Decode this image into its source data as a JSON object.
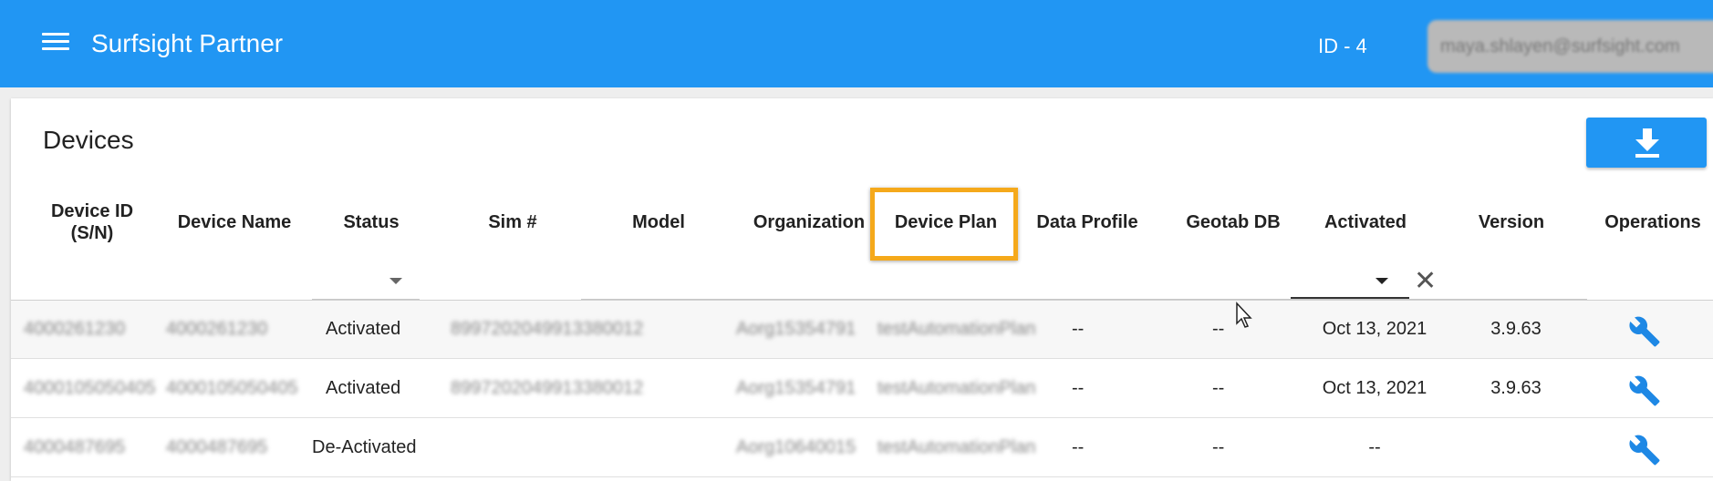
{
  "appbar": {
    "title": "Surfsight Partner",
    "id_label": "ID - 4",
    "user_email": "maya.shlayen@surfsight.com"
  },
  "page": {
    "title": "Devices"
  },
  "table": {
    "columns": {
      "device_id": "Device ID (S/N)",
      "device_name": "Device Name",
      "status": "Status",
      "sim": "Sim #",
      "model": "Model",
      "organization": "Organization",
      "device_plan": "Device Plan",
      "data_profile": "Data Profile",
      "geotab_db": "Geotab DB",
      "activated": "Activated",
      "version": "Version",
      "operations": "Operations"
    },
    "rows": [
      {
        "device_id": "4000261230",
        "device_name": "4000261230",
        "status": "Activated",
        "sim": "8997202049913380012",
        "model": "",
        "organization": "Aorg15354791",
        "device_plan": "testAutomationPlan",
        "data_profile": "--",
        "geotab_db": "--",
        "activated": "Oct 13, 2021",
        "version": "3.9.63"
      },
      {
        "device_id": "4000105050405",
        "device_name": "4000105050405",
        "status": "Activated",
        "sim": "8997202049913380012",
        "model": "",
        "organization": "Aorg15354791",
        "device_plan": "testAutomationPlan",
        "data_profile": "--",
        "geotab_db": "--",
        "activated": "Oct 13, 2021",
        "version": "3.9.63"
      },
      {
        "device_id": "4000487695",
        "device_name": "4000487695",
        "status": "De-Activated",
        "sim": "",
        "model": "",
        "organization": "Aorg10640015",
        "device_plan": "testAutomationPlan",
        "data_profile": "--",
        "geotab_db": "--",
        "activated": "--",
        "version": ""
      }
    ]
  },
  "colors": {
    "appbar": "#2196f3",
    "highlight": "#f5a91b",
    "wrench": "#1e88e5"
  },
  "icons": {
    "menu": "hamburger-menu-icon",
    "download": "download-icon",
    "operations": "wrench-icon",
    "clear": "close-icon"
  }
}
